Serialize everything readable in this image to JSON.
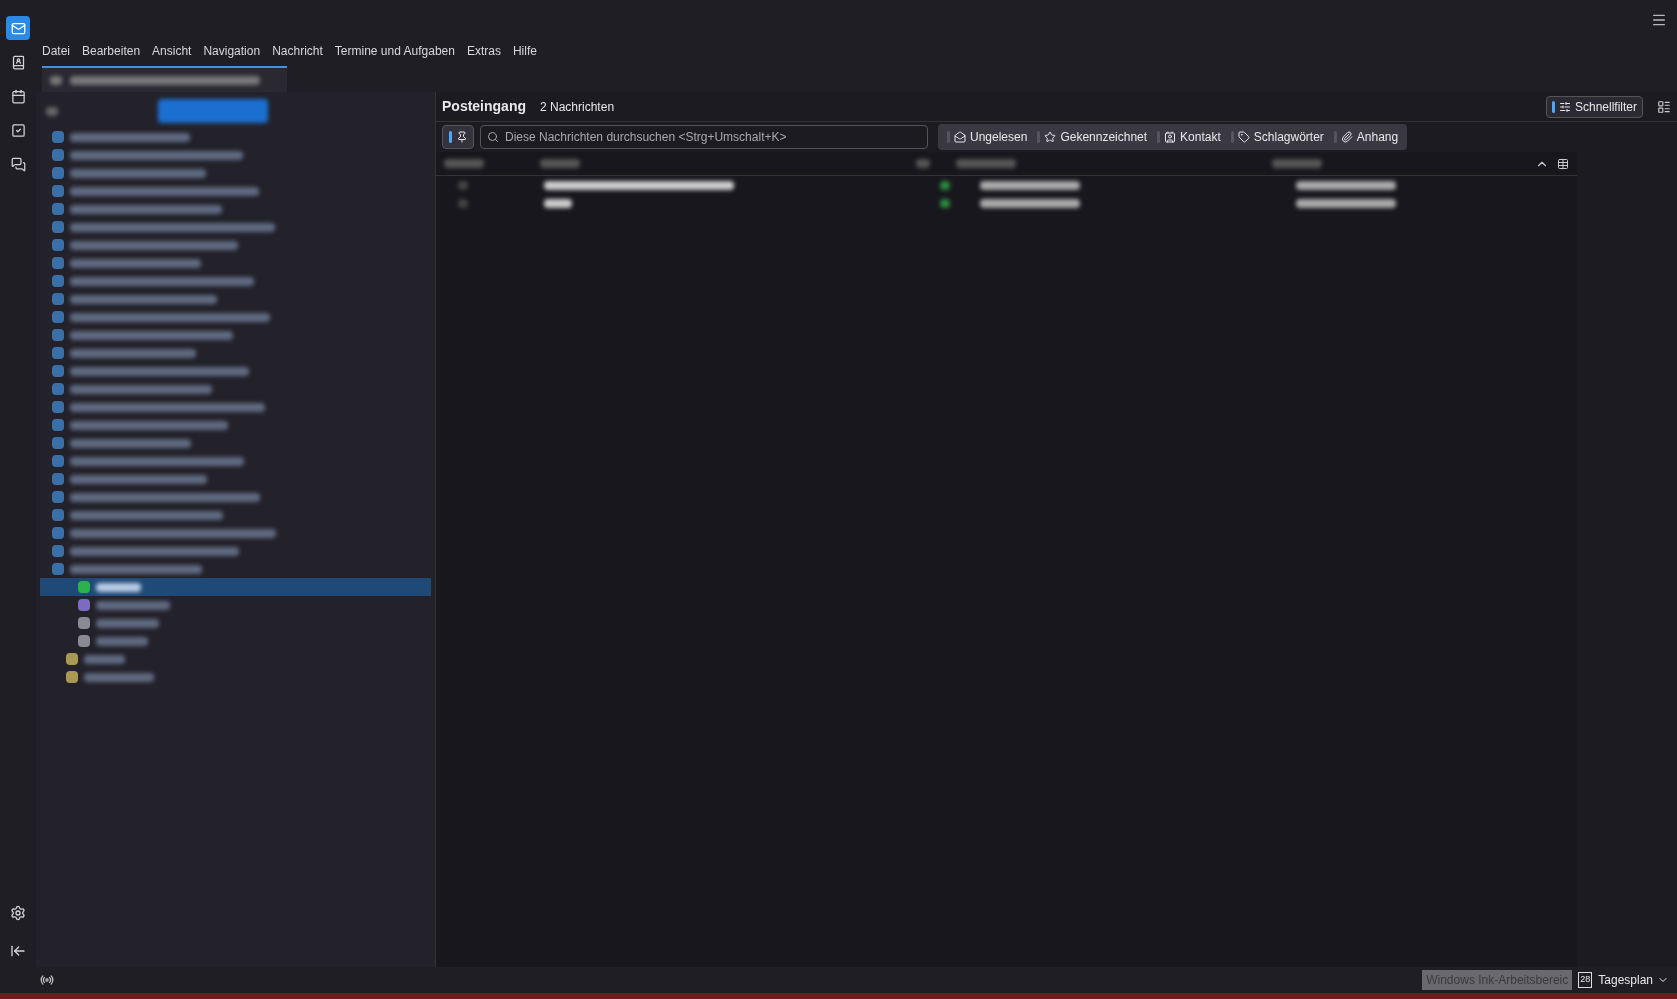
{
  "spaces": [
    {
      "kind": "mail",
      "selected": true
    },
    {
      "kind": "contacts",
      "selected": false
    },
    {
      "kind": "calendar",
      "selected": false
    },
    {
      "kind": "tasks",
      "selected": false
    },
    {
      "kind": "chat",
      "selected": false
    }
  ],
  "menu": [
    "Datei",
    "Bearbeiten",
    "Ansicht",
    "Navigation",
    "Nachricht",
    "Termine und Aufgaben",
    "Extras",
    "Hilfe"
  ],
  "folders": [
    {
      "kind": "account",
      "selected": false
    },
    {
      "kind": "account",
      "selected": false
    },
    {
      "kind": "account",
      "selected": false
    },
    {
      "kind": "account",
      "selected": false
    },
    {
      "kind": "account",
      "selected": false
    },
    {
      "kind": "account",
      "selected": false
    },
    {
      "kind": "account",
      "selected": false
    },
    {
      "kind": "account",
      "selected": false
    },
    {
      "kind": "account",
      "selected": false
    },
    {
      "kind": "account",
      "selected": false
    },
    {
      "kind": "account",
      "selected": false
    },
    {
      "kind": "account",
      "selected": false
    },
    {
      "kind": "account",
      "selected": false
    },
    {
      "kind": "account",
      "selected": false
    },
    {
      "kind": "account",
      "selected": false
    },
    {
      "kind": "account",
      "selected": false
    },
    {
      "kind": "account",
      "selected": false
    },
    {
      "kind": "account",
      "selected": false
    },
    {
      "kind": "account",
      "selected": false
    },
    {
      "kind": "account",
      "selected": false
    },
    {
      "kind": "account",
      "selected": false
    },
    {
      "kind": "account",
      "selected": false
    },
    {
      "kind": "account",
      "selected": false
    },
    {
      "kind": "account",
      "selected": false
    },
    {
      "kind": "account",
      "selected": false
    },
    {
      "kind": "folder",
      "selected": true,
      "color": "#2bb24c"
    },
    {
      "kind": "folder",
      "selected": false,
      "color": "#7d6bc0"
    },
    {
      "kind": "folder",
      "selected": false,
      "color": "#8a8a94"
    },
    {
      "kind": "folder",
      "selected": false,
      "color": "#8a8a94"
    },
    {
      "kind": "subfolder",
      "selected": false,
      "color": "#a89a55"
    },
    {
      "kind": "subfolder",
      "selected": false,
      "color": "#a89a55"
    }
  ],
  "mail_header": {
    "folder": "Posteingang",
    "count": "2 Nachrichten"
  },
  "quick_filter": {
    "label": "Schnellfilter",
    "on": true
  },
  "sticky": {
    "on": true
  },
  "search": {
    "placeholder": "Diese Nachrichten durchsuchen <Strg+Umschalt+K>"
  },
  "filters": [
    {
      "kind": "unread",
      "label": "Ungelesen",
      "on": false
    },
    {
      "kind": "starred",
      "label": "Gekennzeichnet",
      "on": false
    },
    {
      "kind": "contact",
      "label": "Kontakt",
      "on": false
    },
    {
      "kind": "tags",
      "label": "Schlagwörter",
      "on": false
    },
    {
      "kind": "attachment",
      "label": "Anhang",
      "on": false
    }
  ],
  "status_bar": {
    "overlay": "Windows Ink-Arbeitsbereic",
    "date": "28",
    "today_pane": "Tagesplan"
  }
}
